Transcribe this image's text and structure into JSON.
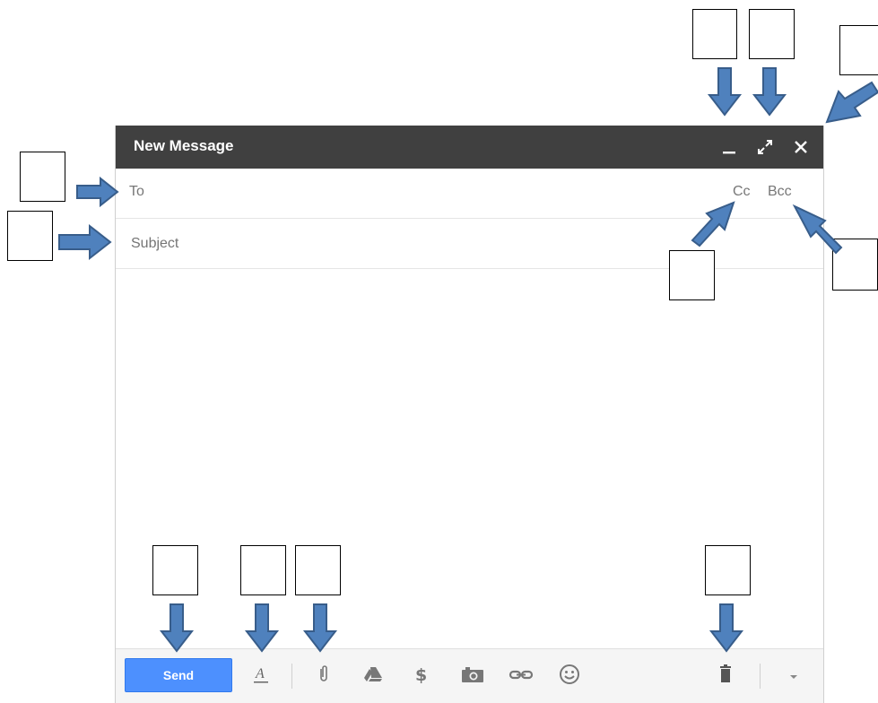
{
  "window": {
    "title": "New Message"
  },
  "titlebar": {
    "minimize_icon": "minimize-icon",
    "expand_icon": "expand-icon",
    "close_icon": "close-icon"
  },
  "fields": {
    "to": {
      "label": "To",
      "value": ""
    },
    "subject": {
      "placeholder": "Subject",
      "value": ""
    },
    "cc_label": "Cc",
    "bcc_label": "Bcc"
  },
  "body": {
    "value": ""
  },
  "toolbar": {
    "send_label": "Send",
    "icons": [
      "formatting-icon",
      "attach-icon",
      "drive-icon",
      "money-icon",
      "camera-icon",
      "link-icon",
      "emoji-icon",
      "trash-icon",
      "more-options-icon"
    ]
  },
  "colors": {
    "titlebar": "#404040",
    "send": "#4d90fe",
    "annotation_arrow": "#4f81bd",
    "annotation_arrow_border": "#385d8a"
  }
}
